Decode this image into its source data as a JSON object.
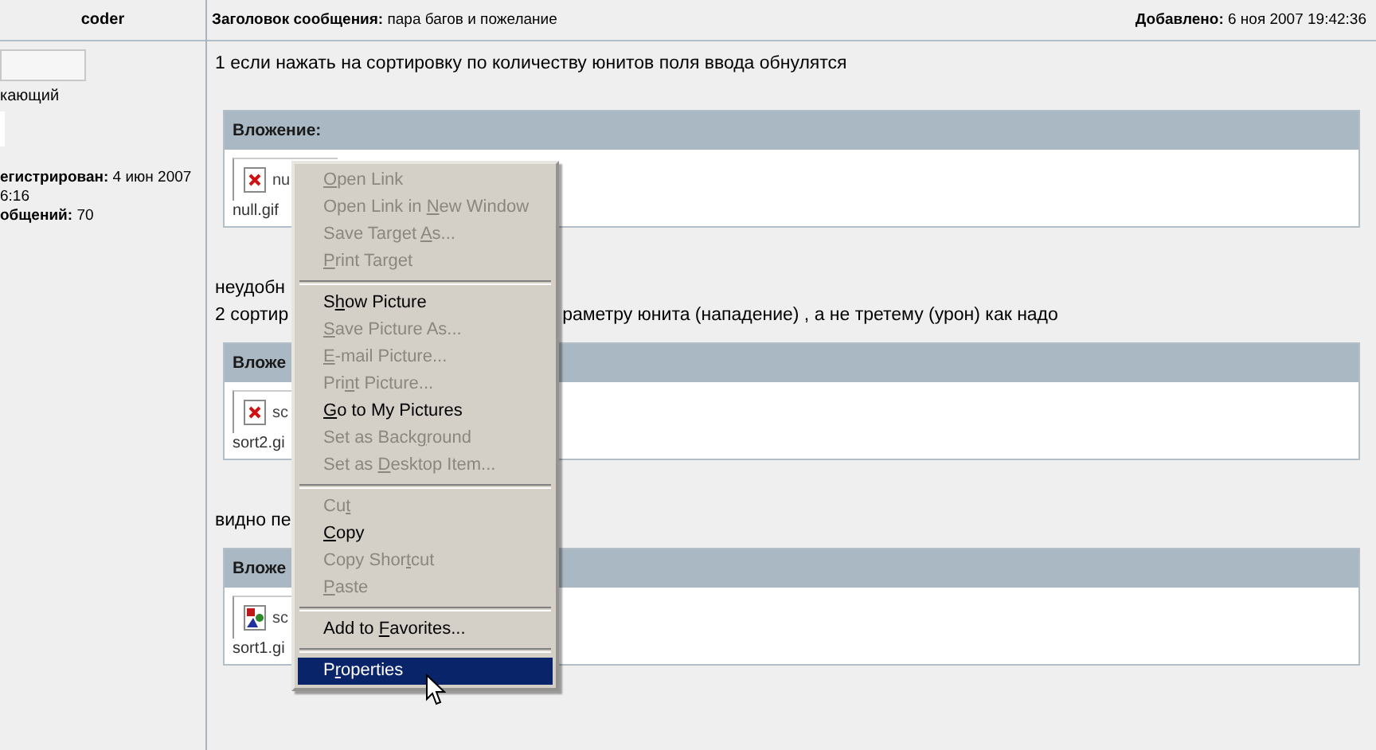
{
  "author_header": "coder",
  "post_header": {
    "subject": "**Заголовок сообщения:** пара багов и пожелание",
    "added": "**Добавлено:** 6 ноя 2007 19:42:36"
  },
  "profile": {
    "rank": "кающий",
    "registered": "**егистрирован:** 4 июн 2007",
    "line_2": "6:16",
    "posts": "**общений:** 70"
  },
  "blocks": [
    {
      "kind": "text",
      "parts": [
        "1 если нажать на сортировку по количеству юнитов поля ввода обнулятся"
      ]
    },
    {
      "kind": "attachment",
      "title": "Вложение:",
      "thumb": {
        "kind": "broken",
        "label": "nu"
      },
      "caption": "null.gif"
    },
    {
      "kind": "text",
      "parts": [
        "неудобн"
      ]
    },
    {
      "kind": "text",
      "parts": [
        "2 сортир",
        "раметру юнита (нападение) , а не третему (урон) как надо"
      ]
    },
    {
      "kind": "attachment",
      "title": "Вложе",
      "thumb": {
        "kind": "broken",
        "label": "sc"
      },
      "caption": "sort2.gi"
    },
    {
      "kind": "text",
      "parts": [
        "видно пе"
      ]
    },
    {
      "kind": "attachment",
      "title": "Вложе",
      "thumb": {
        "kind": "image",
        "label": "sc"
      },
      "caption": "sort1.gi"
    }
  ],
  "context_menu": [
    {
      "kind": "item",
      "key": "O",
      "post": "pen Link",
      "disabled": true,
      "selected": false
    },
    {
      "kind": "item",
      "pre": "Open Link in ",
      "key": "N",
      "post": "ew Window",
      "disabled": true,
      "selected": false
    },
    {
      "kind": "item",
      "pre": "Save Target ",
      "key": "A",
      "post": "s...",
      "disabled": true,
      "selected": false
    },
    {
      "kind": "item",
      "key": "P",
      "post": "rint Target",
      "disabled": true,
      "selected": false
    },
    {
      "kind": "separator"
    },
    {
      "kind": "item",
      "pre": "S",
      "key": "h",
      "post": "ow Picture",
      "disabled": false,
      "selected": false
    },
    {
      "kind": "item",
      "key": "S",
      "post": "ave Picture As...",
      "disabled": true,
      "selected": false
    },
    {
      "kind": "item",
      "key": "E",
      "post": "-mail Picture...",
      "disabled": true,
      "selected": false
    },
    {
      "kind": "item",
      "pre": "Pri",
      "key": "n",
      "post": "t Picture...",
      "disabled": true,
      "selected": false
    },
    {
      "kind": "item",
      "key": "G",
      "post": "o to My Pictures",
      "disabled": false,
      "selected": false
    },
    {
      "kind": "item",
      "pre": "Set as Back",
      "key": "g",
      "post": "round",
      "disabled": true,
      "selected": false
    },
    {
      "kind": "item",
      "pre": "Set as ",
      "key": "D",
      "post": "esktop Item...",
      "disabled": true,
      "selected": false
    },
    {
      "kind": "separator"
    },
    {
      "kind": "item",
      "pre": "Cu",
      "key": "t",
      "disabled": true,
      "selected": false
    },
    {
      "kind": "item",
      "key": "C",
      "post": "opy",
      "disabled": false,
      "selected": false
    },
    {
      "kind": "item",
      "pre": "Copy Shor",
      "key": "t",
      "post": "cut",
      "disabled": true,
      "selected": false
    },
    {
      "kind": "item",
      "key": "P",
      "post": "aste",
      "disabled": true,
      "selected": false
    },
    {
      "kind": "separator"
    },
    {
      "kind": "item",
      "pre": "Add to ",
      "key": "F",
      "post": "avorites...",
      "disabled": false,
      "selected": false
    },
    {
      "kind": "separator"
    },
    {
      "kind": "item",
      "pre": "P",
      "key": "r",
      "post": "operties",
      "disabled": false,
      "selected": true
    }
  ]
}
